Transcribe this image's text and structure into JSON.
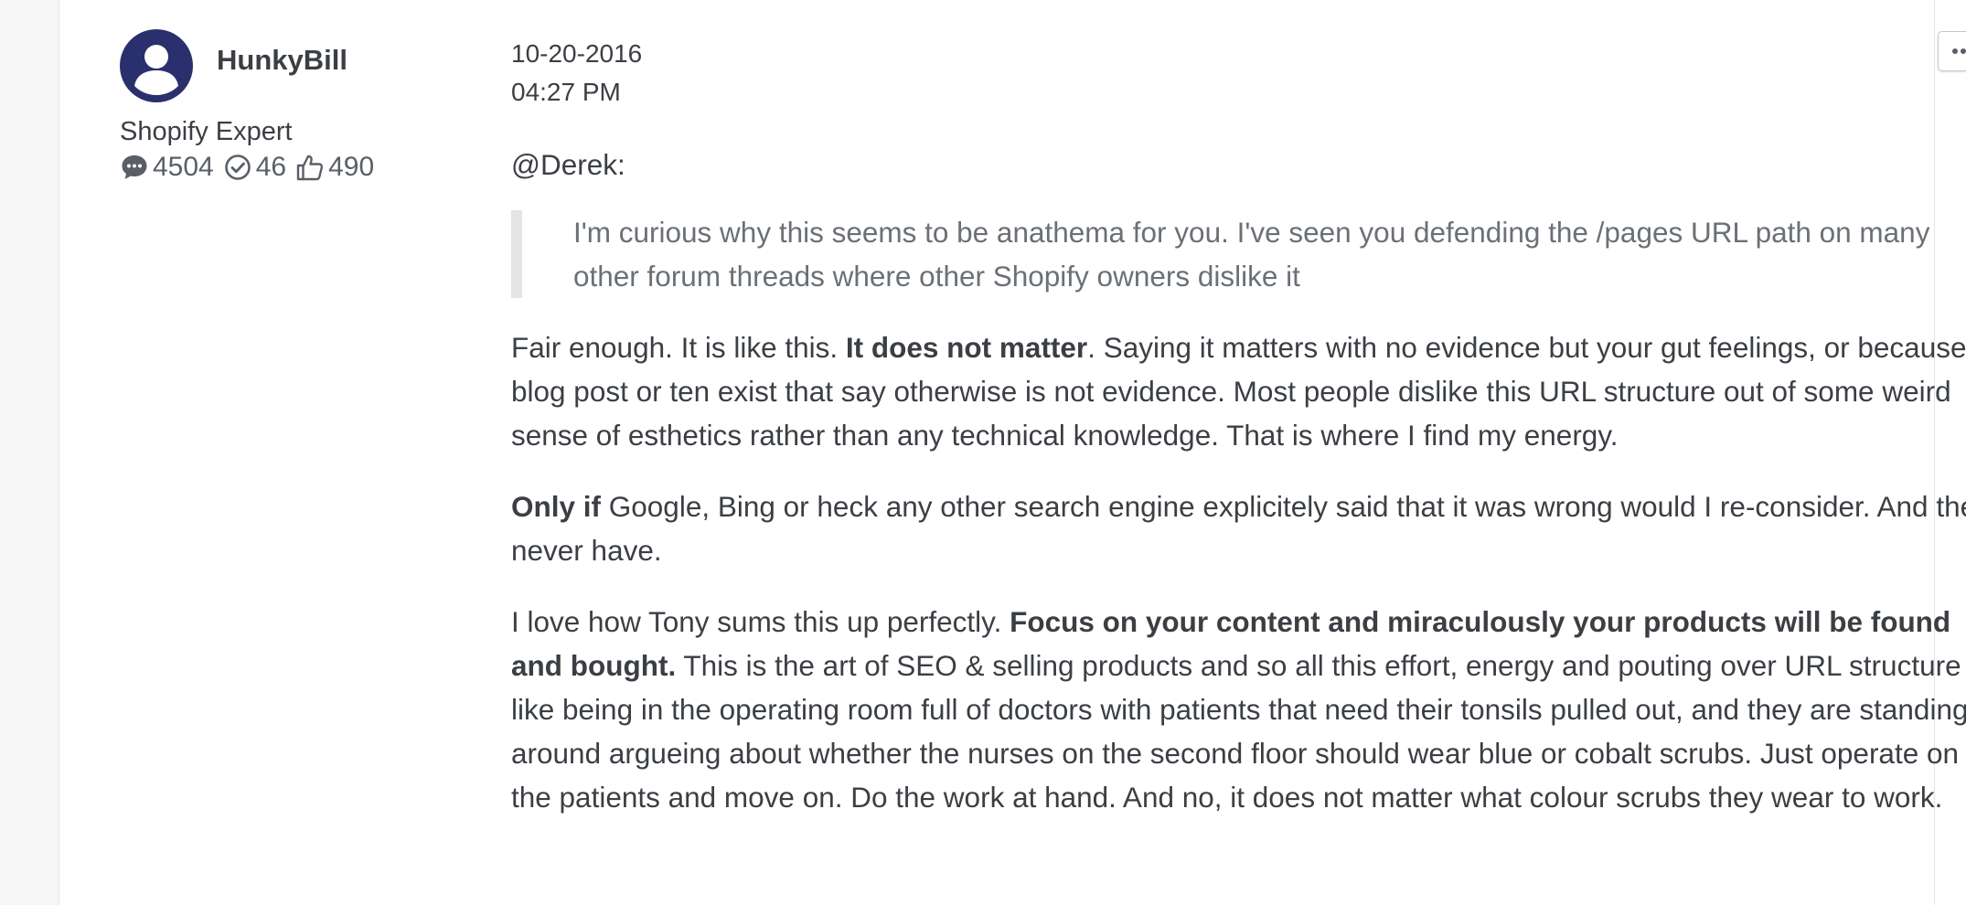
{
  "author": {
    "name": "HunkyBill",
    "rank": "Shopify Expert",
    "stats": {
      "posts": "4504",
      "solutions": "46",
      "likes": "490"
    }
  },
  "post": {
    "date": "10-20-2016",
    "time": "04:27 PM",
    "mention": "@Derek:",
    "quote": "I'm curious why this seems to be anathema for you. I've seen you defending the /pages URL path on many other forum threads where other Shopify owners dislike it",
    "p1": {
      "a": "Fair enough. It is like this. ",
      "bold": "It does not matter",
      "b": ". Saying it matters with no evidence but your gut feelings, or because a blog post or ten exist that say otherwise is not evidence. Most people dislike this URL structure out of some weird sense of esthetics rather than any technical knowledge. That is where I find my energy."
    },
    "p2": {
      "bold": "Only if",
      "a": " Google, Bing or heck any other search engine explicitely said that it was wrong would I re-consider. And they never have."
    },
    "p3": {
      "a": "I love how Tony sums this up perfectly. ",
      "bold": "Focus on your content and miraculously your products will be found and bought.",
      "b": " This is the art of SEO & selling products and so all this effort, energy and pouting over URL structure is like being in the operating room full of doctors with patients that need their tonsils pulled out, and they are standing around argueing about whether the nurses on the second floor should wear blue or cobalt scrubs. Just operate on the patients and move on. Do the work at hand. And no, it does not matter what colour scrubs they wear to work."
    }
  },
  "icons": {
    "avatar": "user-avatar-icon",
    "posts": "speech-bubble-icon",
    "solutions": "check-circle-icon",
    "likes": "thumbs-up-icon",
    "menu": "more-horizontal-icon"
  },
  "colors": {
    "avatar_bg": "#29306d",
    "text": "#3b3f44",
    "quote_text": "#6b7076",
    "quote_border": "#e3e4e6"
  }
}
